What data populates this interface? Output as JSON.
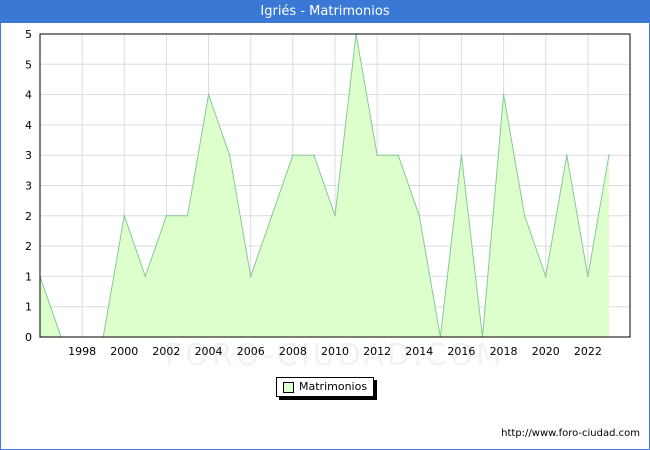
{
  "title": "Igriés - Matrimonios",
  "source_url": "http://www.foro-ciudad.com",
  "watermark": "FORO-CIUDAD.COM",
  "colors": {
    "title_bg": "#3a78d6",
    "fill": "#dcffcc",
    "line": "#88c898",
    "grid": "#dddddd"
  },
  "chart_data": {
    "type": "area",
    "x": [
      1996,
      1997,
      1998,
      1999,
      2000,
      2001,
      2002,
      2003,
      2004,
      2005,
      2006,
      2007,
      2008,
      2009,
      2010,
      2011,
      2012,
      2013,
      2014,
      2015,
      2016,
      2017,
      2018,
      2019,
      2020,
      2021,
      2022,
      2023
    ],
    "series": [
      {
        "name": "Matrimonios",
        "values": [
          1,
          0,
          0,
          0,
          2,
          1,
          2,
          2,
          4,
          3,
          1,
          2,
          3,
          3,
          2,
          5,
          3,
          3,
          2,
          0,
          3,
          0,
          4,
          2,
          1,
          3,
          1,
          3
        ]
      }
    ],
    "xticks": [
      "1998",
      "2000",
      "2002",
      "2004",
      "2006",
      "2008",
      "2010",
      "2012",
      "2014",
      "2016",
      "2018",
      "2020",
      "2022"
    ],
    "yticks": [
      "0",
      "1",
      "1",
      "2",
      "2",
      "3",
      "3",
      "4",
      "4",
      "5",
      "5"
    ],
    "ylim": [
      0,
      5
    ],
    "grid": true,
    "legend_position": "bottom-center"
  }
}
